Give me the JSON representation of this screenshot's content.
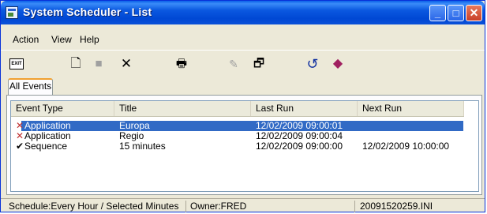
{
  "window": {
    "title": "System Scheduler - List",
    "minimize_label": "_",
    "maximize_label": "□",
    "close_label": "✕"
  },
  "menu": {
    "items": [
      {
        "label": "Action"
      },
      {
        "label": "View"
      },
      {
        "label": "Help"
      }
    ]
  },
  "toolbar": {
    "exit_label": "EXIT",
    "new_glyph": "🗋",
    "stop_glyph": "■",
    "delete_glyph": "✕",
    "print_glyph": "🖶",
    "edit_glyph": "✎",
    "properties_glyph": "🗗",
    "refresh_glyph": "↺",
    "help_glyph": "◆"
  },
  "tabs": [
    {
      "label": "All Events",
      "active": true
    }
  ],
  "list": {
    "columns": [
      "Event Type",
      "Title",
      "Last Run",
      "Next Run"
    ],
    "rows": [
      {
        "status": "x",
        "event_type": "Application",
        "title": "Europa",
        "last_run": "12/02/2009 09:00:01",
        "next_run": "",
        "selected": true
      },
      {
        "status": "x",
        "event_type": "Application",
        "title": "Regio",
        "last_run": "12/02/2009 09:00:04",
        "next_run": "",
        "selected": false
      },
      {
        "status": "check",
        "event_type": "Sequence",
        "title": "15 minutes",
        "last_run": "12/02/2009 09:00:00",
        "next_run": "12/02/2009 10:00:00",
        "selected": false
      }
    ]
  },
  "status_bar": {
    "schedule": "Schedule:Every Hour / Selected Minutes",
    "owner": "Owner:FRED",
    "file": "20091520259.INI"
  },
  "colors": {
    "titlebar": "#0054e3",
    "selection": "#316ac5",
    "failed_mark": "#c03030"
  }
}
